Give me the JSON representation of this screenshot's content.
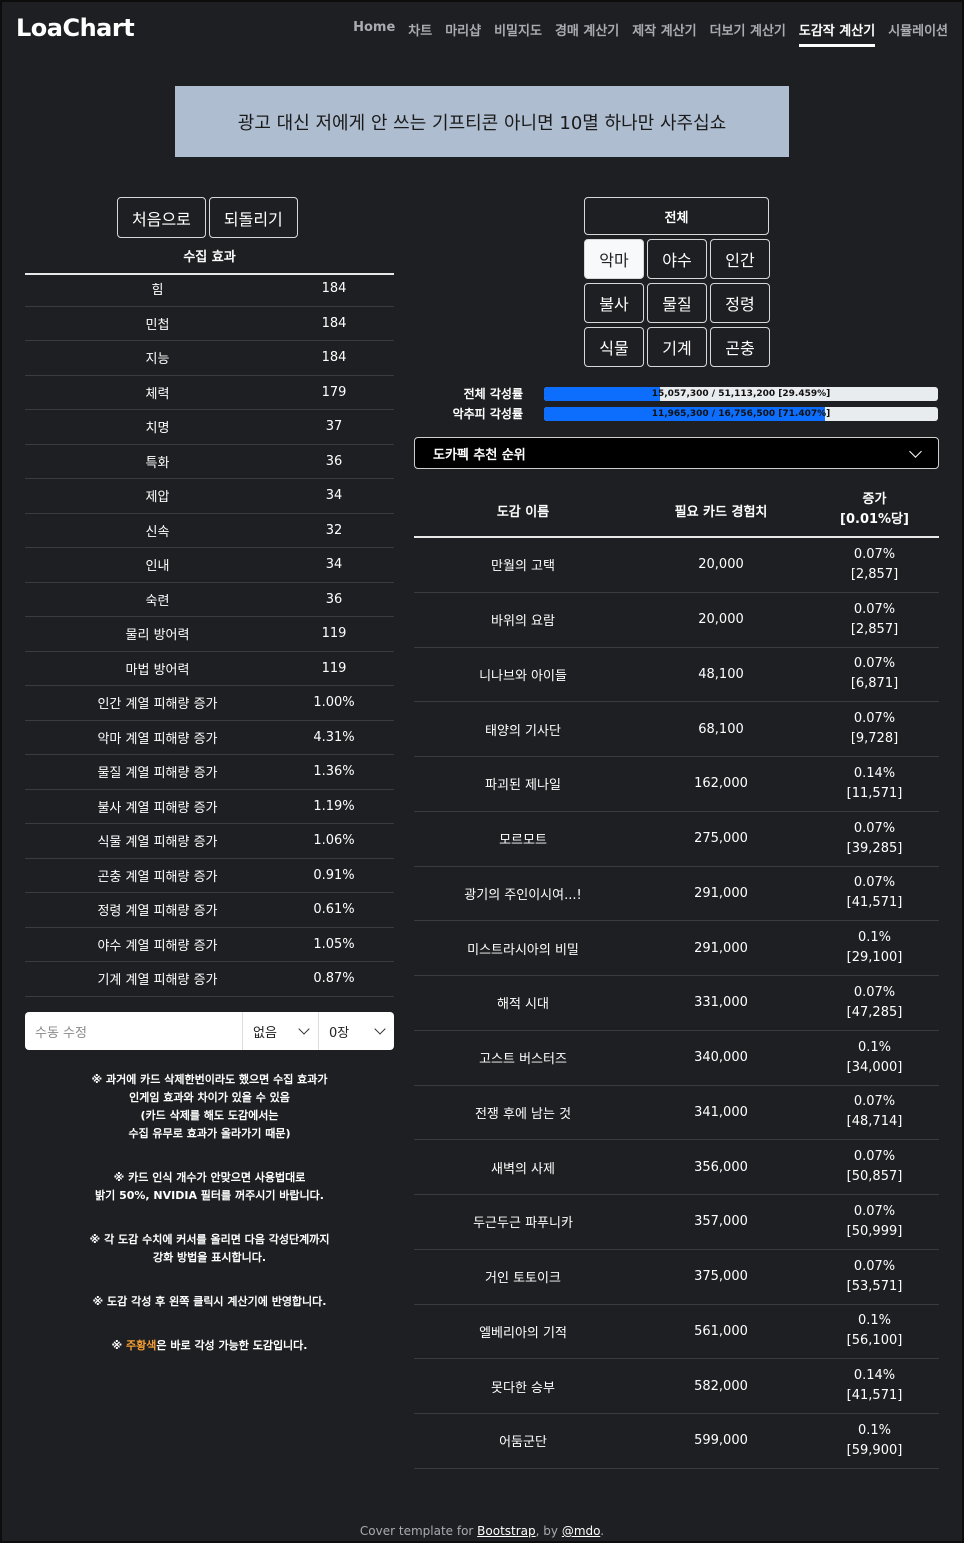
{
  "brand": "LoaChart",
  "nav": [
    "Home",
    "차트",
    "마리샵",
    "비밀지도",
    "경매 계산기",
    "제작 계산기",
    "더보기 계산기",
    "도감작 계산기",
    "시뮬레이션"
  ],
  "nav_active": "도감작 계산기",
  "ad_text": "광고 대신 저에게 안 쓰는 기프티콘 아니면 10멸 하나만 사주십쇼",
  "left": {
    "reset_label": "처음으로",
    "undo_label": "되돌리기",
    "stats_title": "수집 효과",
    "stats": [
      {
        "name": "힘",
        "value": "184"
      },
      {
        "name": "민첩",
        "value": "184"
      },
      {
        "name": "지능",
        "value": "184"
      },
      {
        "name": "체력",
        "value": "179"
      },
      {
        "name": "치명",
        "value": "37"
      },
      {
        "name": "특화",
        "value": "36"
      },
      {
        "name": "제압",
        "value": "34"
      },
      {
        "name": "신속",
        "value": "32"
      },
      {
        "name": "인내",
        "value": "34"
      },
      {
        "name": "숙련",
        "value": "36"
      },
      {
        "name": "물리 방어력",
        "value": "119"
      },
      {
        "name": "마법 방어력",
        "value": "119"
      },
      {
        "name": "인간 계열 피해량 증가",
        "value": "1.00%"
      },
      {
        "name": "악마 계열 피해량 증가",
        "value": "4.31%"
      },
      {
        "name": "물질 계열 피해량 증가",
        "value": "1.36%"
      },
      {
        "name": "불사 계열 피해량 증가",
        "value": "1.19%"
      },
      {
        "name": "식물 계열 피해량 증가",
        "value": "1.06%"
      },
      {
        "name": "곤충 계열 피해량 증가",
        "value": "0.91%"
      },
      {
        "name": "정령 계열 피해량 증가",
        "value": "0.61%"
      },
      {
        "name": "야수 계열 피해량 증가",
        "value": "1.05%"
      },
      {
        "name": "기계 계열 피해량 증가",
        "value": "0.87%"
      }
    ],
    "manual_placeholder": "수동 수정",
    "manual_select1": "없음",
    "manual_select2": "0장",
    "notes": [
      [
        "※ 과거에 카드 삭제한번이라도 했으면 수집 효과가",
        "인게임 효과와 차이가 있을 수 있음",
        "(카드 삭제를 해도 도감에서는",
        "수집 유무로 효과가 올라가기 때문)"
      ],
      [
        "※ 카드 인식 개수가 안맞으면 사용법대로",
        "밝기 50%, NVIDIA 필터를 꺼주시기 바랍니다."
      ],
      [
        "※ 각 도감 수치에 커서를 올리면 다음 각성단계까지",
        "강화 방법을 표시합니다."
      ],
      [
        "※ 도감 각성 후 왼쪽 클릭시 계산기에 반영합니다."
      ]
    ],
    "note_orange_prefix": "※ ",
    "note_orange_word": "주황색",
    "note_orange_suffix": "은 바로 각성 가능한 도감입니다."
  },
  "right": {
    "all_label": "전체",
    "categories": [
      "악마",
      "야수",
      "인간",
      "불사",
      "물질",
      "정령",
      "식물",
      "기계",
      "곤충"
    ],
    "active_category": "악마",
    "progress": [
      {
        "label": "전체 각성률",
        "text": "15,057,300 / 51,113,200 [29.459%]",
        "percent": 29.459
      },
      {
        "label": "악추피 각성률",
        "text": "11,965,300 / 16,756,500 [71.407%]",
        "percent": 71.407
      }
    ],
    "dropdown_label": "도카펙 추천 순위",
    "table_headers": [
      "도감 이름",
      "필요 카드 경험치",
      "증가",
      "[0.01%당]"
    ],
    "rows": [
      {
        "name": "만월의 고택",
        "exp": "20,000",
        "inc": "0.07%",
        "per": "[2,857]"
      },
      {
        "name": "바위의 요람",
        "exp": "20,000",
        "inc": "0.07%",
        "per": "[2,857]"
      },
      {
        "name": "니나브와 아이들",
        "exp": "48,100",
        "inc": "0.07%",
        "per": "[6,871]"
      },
      {
        "name": "태양의 기사단",
        "exp": "68,100",
        "inc": "0.07%",
        "per": "[9,728]"
      },
      {
        "name": "파괴된 제나일",
        "exp": "162,000",
        "inc": "0.14%",
        "per": "[11,571]"
      },
      {
        "name": "모르모트",
        "exp": "275,000",
        "inc": "0.07%",
        "per": "[39,285]"
      },
      {
        "name": "광기의 주인이시여...!",
        "exp": "291,000",
        "inc": "0.07%",
        "per": "[41,571]"
      },
      {
        "name": "미스트라시아의 비밀",
        "exp": "291,000",
        "inc": "0.1%",
        "per": "[29,100]"
      },
      {
        "name": "해적 시대",
        "exp": "331,000",
        "inc": "0.07%",
        "per": "[47,285]"
      },
      {
        "name": "고스트 버스터즈",
        "exp": "340,000",
        "inc": "0.1%",
        "per": "[34,000]"
      },
      {
        "name": "전쟁 후에 남는 것",
        "exp": "341,000",
        "inc": "0.07%",
        "per": "[48,714]"
      },
      {
        "name": "새벽의 사제",
        "exp": "356,000",
        "inc": "0.07%",
        "per": "[50,857]"
      },
      {
        "name": "두근두근 파푸니카",
        "exp": "357,000",
        "inc": "0.07%",
        "per": "[50,999]"
      },
      {
        "name": "거인 토토이크",
        "exp": "375,000",
        "inc": "0.07%",
        "per": "[53,571]"
      },
      {
        "name": "엘베리아의 기적",
        "exp": "561,000",
        "inc": "0.1%",
        "per": "[56,100]"
      },
      {
        "name": "못다한 승부",
        "exp": "582,000",
        "inc": "0.14%",
        "per": "[41,571]"
      },
      {
        "name": "어둠군단",
        "exp": "599,000",
        "inc": "0.1%",
        "per": "[59,900]"
      }
    ]
  },
  "footer": {
    "prefix": "Cover template for ",
    "link1": "Bootstrap",
    "mid": ", by ",
    "link2": "@mdo",
    "suffix": "."
  },
  "colors": {
    "background": "#1e1f22",
    "accent": "#0d6efd",
    "ad_bg": "#aebdd0",
    "orange": "#f39c33"
  }
}
